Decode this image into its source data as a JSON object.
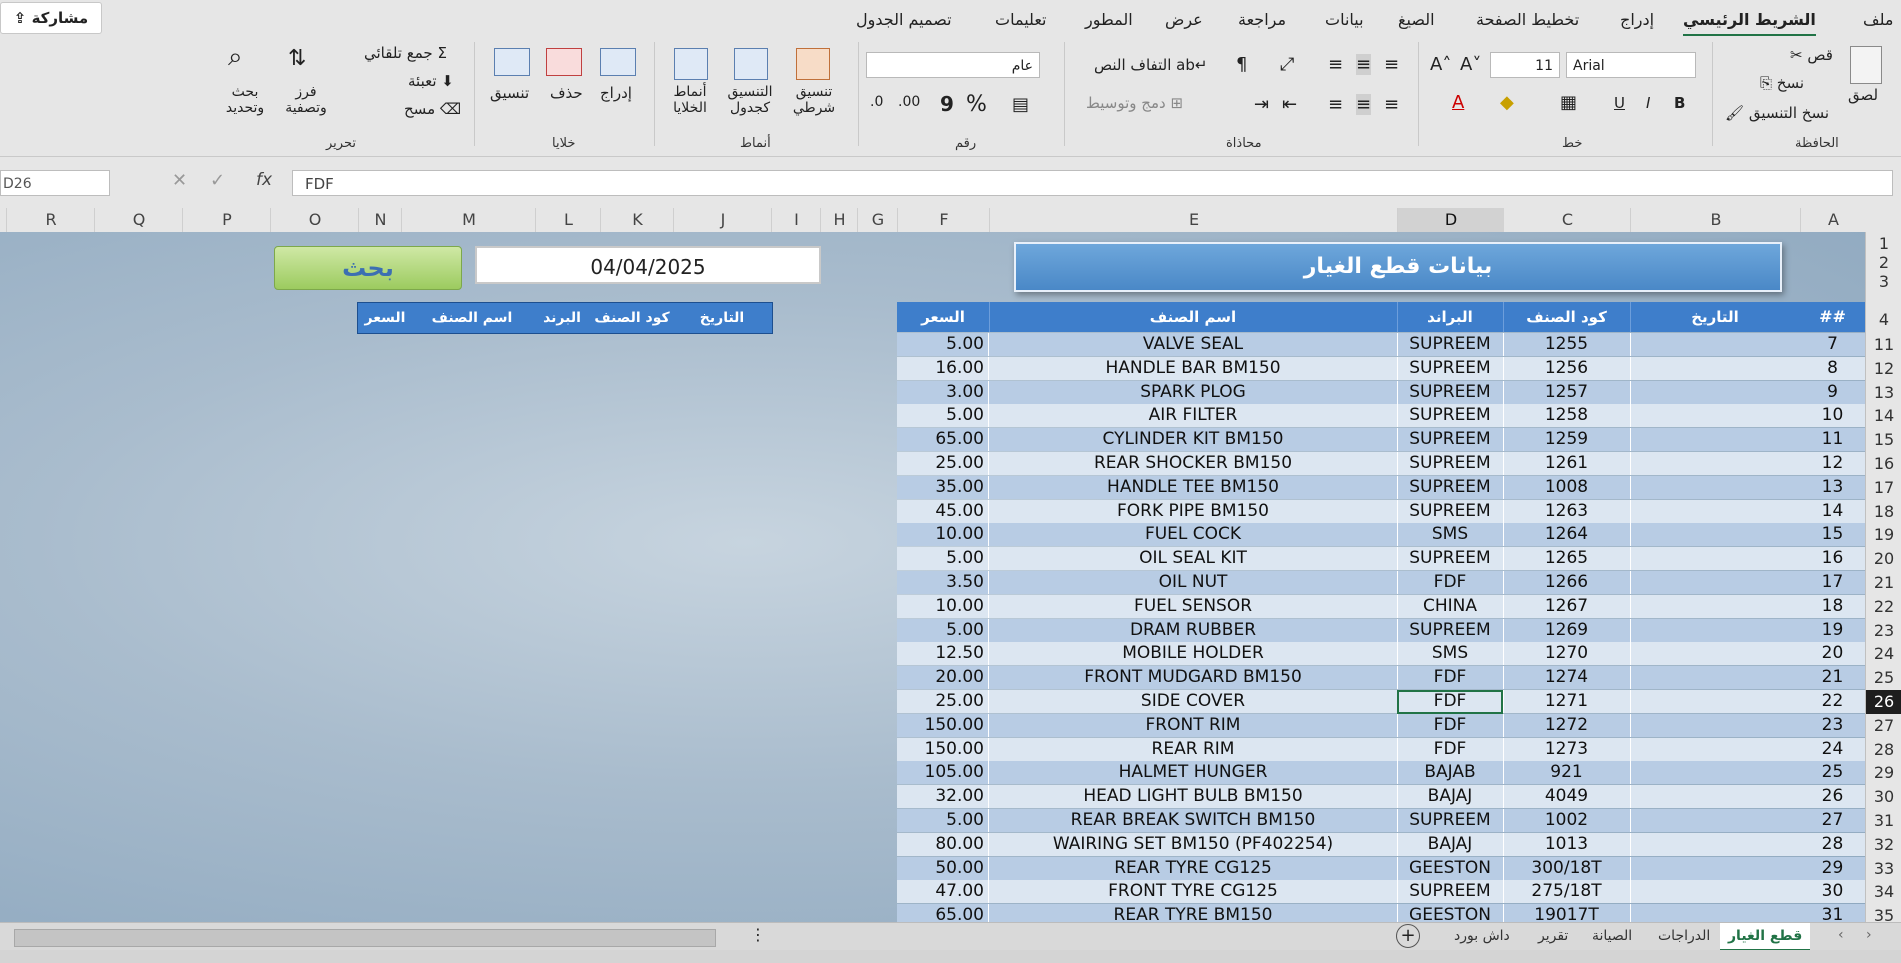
{
  "share": {
    "label": "مشاركة"
  },
  "ribbon_tabs": [
    {
      "label": "ملف"
    },
    {
      "label": "الشريط الرئيسي"
    },
    {
      "label": "إدراج"
    },
    {
      "label": "تخطيط الصفحة"
    },
    {
      "label": "الصيغ"
    },
    {
      "label": "بيانات"
    },
    {
      "label": "مراجعة"
    },
    {
      "label": "عرض"
    },
    {
      "label": "المطور"
    },
    {
      "label": "تعليمات"
    },
    {
      "label": "تصميم الجدول"
    }
  ],
  "ribbon": {
    "clipboard": {
      "group": "الحافظة",
      "paste": "لصق",
      "cut": "قص",
      "copy": "نسخ",
      "format_painter": "نسخ التنسيق"
    },
    "font": {
      "group": "خط",
      "font_name": "Arial",
      "font_size": "11",
      "bold": "B",
      "italic": "I",
      "underline": "U"
    },
    "alignment": {
      "group": "محاذاة",
      "wrap": "التفاف النص",
      "merge": "دمج وتوسيط"
    },
    "number": {
      "group": "رقم",
      "format": "عام",
      "percent": "%",
      "comma": "9"
    },
    "styles": {
      "group": "أنماط",
      "conditional": "تنسيق شرطي",
      "as_table": "التنسيق كجدول",
      "cell_styles": "أنماط الخلايا"
    },
    "cells": {
      "group": "خلايا",
      "insert": "إدراج",
      "delete": "حذف",
      "format": "تنسيق"
    },
    "editing": {
      "group": "تحرير",
      "autosum": "جمع تلقائي",
      "fill": "تعبئة",
      "clear": "مسح",
      "sort": "فرز وتصفية",
      "find": "بحث وتحديد"
    }
  },
  "formula": {
    "name_box": "D26",
    "fx": "fx",
    "value": "FDF"
  },
  "columns": [
    "A",
    "B",
    "C",
    "D",
    "E",
    "F",
    "G",
    "H",
    "I",
    "J",
    "K",
    "L",
    "M",
    "N",
    "O",
    "P",
    "Q",
    "R"
  ],
  "selected_column": "D",
  "title": "بيانات قطع الغيار",
  "search": {
    "button": "بحث",
    "date": "04/04/2025",
    "headers": [
      "التاريخ",
      "كود الصنف",
      "البرند",
      "اسم الصنف",
      "السعر"
    ]
  },
  "table": {
    "headers": {
      "num": "##",
      "date": "التاريخ",
      "code": "كود الصنف",
      "brand": "البراند",
      "name": "اسم الصنف",
      "price": "السعر"
    },
    "rows": [
      {
        "n": "7",
        "code": "1255",
        "brand": "SUPREEM",
        "name": "VALVE SEAL",
        "price": "5.00"
      },
      {
        "n": "8",
        "code": "1256",
        "brand": "SUPREEM",
        "name": "HANDLE BAR BM150",
        "price": "16.00"
      },
      {
        "n": "9",
        "code": "1257",
        "brand": "SUPREEM",
        "name": "SPARK PLOG",
        "price": "3.00"
      },
      {
        "n": "10",
        "code": "1258",
        "brand": "SUPREEM",
        "name": "AIR FILTER",
        "price": "5.00"
      },
      {
        "n": "11",
        "code": "1259",
        "brand": "SUPREEM",
        "name": "CYLINDER KIT BM150",
        "price": "65.00"
      },
      {
        "n": "12",
        "code": "1261",
        "brand": "SUPREEM",
        "name": "REAR SHOCKER BM150",
        "price": "25.00"
      },
      {
        "n": "13",
        "code": "1008",
        "brand": "SUPREEM",
        "name": "HANDLE TEE BM150",
        "price": "35.00"
      },
      {
        "n": "14",
        "code": "1263",
        "brand": "SUPREEM",
        "name": "FORK PIPE BM150",
        "price": "45.00"
      },
      {
        "n": "15",
        "code": "1264",
        "brand": "SMS",
        "name": "FUEL COCK",
        "price": "10.00"
      },
      {
        "n": "16",
        "code": "1265",
        "brand": "SUPREEM",
        "name": "OIL SEAL KIT",
        "price": "5.00"
      },
      {
        "n": "17",
        "code": "1266",
        "brand": "FDF",
        "name": "OIL NUT",
        "price": "3.50"
      },
      {
        "n": "18",
        "code": "1267",
        "brand": "CHINA",
        "name": "FUEL SENSOR",
        "price": "10.00"
      },
      {
        "n": "19",
        "code": "1269",
        "brand": "SUPREEM",
        "name": "DRAM RUBBER",
        "price": "5.00"
      },
      {
        "n": "20",
        "code": "1270",
        "brand": "SMS",
        "name": "MOBILE HOLDER",
        "price": "12.50"
      },
      {
        "n": "21",
        "code": "1274",
        "brand": "FDF",
        "name": "FRONT MUDGARD BM150",
        "price": "20.00"
      },
      {
        "n": "22",
        "code": "1271",
        "brand": "FDF",
        "name": "SIDE COVER",
        "price": "25.00"
      },
      {
        "n": "23",
        "code": "1272",
        "brand": "FDF",
        "name": "FRONT RIM",
        "price": "150.00"
      },
      {
        "n": "24",
        "code": "1273",
        "brand": "FDF",
        "name": "REAR RIM",
        "price": "150.00"
      },
      {
        "n": "25",
        "code": "921",
        "brand": "BAJAB",
        "name": "HALMET HUNGER",
        "price": "105.00"
      },
      {
        "n": "26",
        "code": "4049",
        "brand": "BAJAJ",
        "name": "HEAD LIGHT BULB BM150",
        "price": "32.00"
      },
      {
        "n": "27",
        "code": "1002",
        "brand": "SUPREEM",
        "name": "REAR BREAK SWITCH BM150",
        "price": "5.00"
      },
      {
        "n": "28",
        "code": "1013",
        "brand": "BAJAJ",
        "name": "WAIRING SET BM150 (PF402254)",
        "price": "80.00"
      },
      {
        "n": "29",
        "code": "300/18T",
        "brand": "GEESTON",
        "name": "REAR TYRE CG125",
        "price": "50.00"
      },
      {
        "n": "30",
        "code": "275/18T",
        "brand": "SUPREEM",
        "name": "FRONT TYRE CG125",
        "price": "47.00"
      },
      {
        "n": "31",
        "code": "19017T",
        "brand": "GEESTON",
        "name": "REAR TYRE BM150",
        "price": "65.00"
      }
    ]
  },
  "row_numbers": [
    "1",
    "2",
    "3",
    "4",
    "11",
    "12",
    "13",
    "14",
    "15",
    "16",
    "17",
    "18",
    "19",
    "20",
    "21",
    "22",
    "23",
    "24",
    "25",
    "26",
    "27",
    "28",
    "29",
    "30",
    "31",
    "32",
    "33",
    "34",
    "35"
  ],
  "selected_row": "26",
  "sheet_tabs": [
    {
      "label": "قطع الغيار"
    },
    {
      "label": "الدراجات"
    },
    {
      "label": "الصيانة"
    },
    {
      "label": "تقرير"
    },
    {
      "label": "داش بورد"
    }
  ],
  "active_sheet": "قطع الغيار",
  "colors": {
    "accent": "#217346",
    "header_blue": "#3e7ecb",
    "row_odd": "#b8cce4",
    "row_even": "#dce6f1"
  }
}
